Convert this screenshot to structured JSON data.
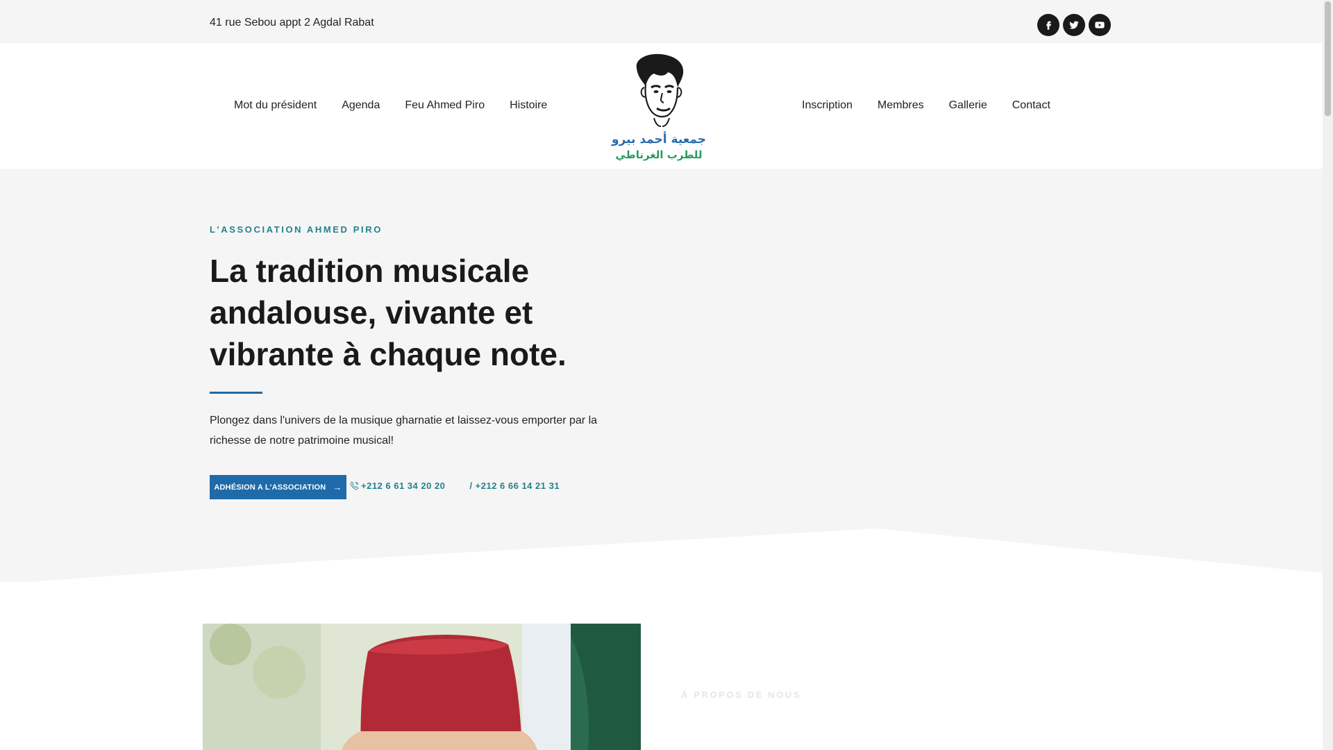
{
  "topbar": {
    "address": "41 rue Sebou appt 2 Agdal Rabat",
    "socials": [
      {
        "icon": "facebook-icon"
      },
      {
        "icon": "twitter-icon"
      },
      {
        "icon": "youtube-icon"
      }
    ]
  },
  "nav": {
    "left": [
      "Mot du président",
      "Agenda",
      "Feu Ahmed Piro",
      "Histoire"
    ],
    "right": [
      "Inscription",
      "Membres",
      "Gallerie",
      "Contact"
    ]
  },
  "logo": {
    "arabic_line1": "جمعية أحمد بيرو",
    "arabic_line2": "للطرب الغرناطي"
  },
  "hero": {
    "kicker": "L'ASSOCIATION AHMED PIRO",
    "title": "La tradition musicale andalouse, vivante et vibrante à chaque note.",
    "lead": "Plongez dans l'univers de la musique gharnatie et laissez-vous emporter par la richesse de notre patrimoine musical!",
    "cta_label": "ADHÉSION A L'ASSOCIATION",
    "phone1": "+212 6 61 34 20 20",
    "phone2": "/ +212 6 66 14 21 31"
  },
  "about": {
    "kicker": "À PROPOS DE NOUS"
  },
  "colors": {
    "accent_teal": "#23818c",
    "button_blue": "#1f6aa8",
    "light_bg": "#f5f5f5"
  }
}
